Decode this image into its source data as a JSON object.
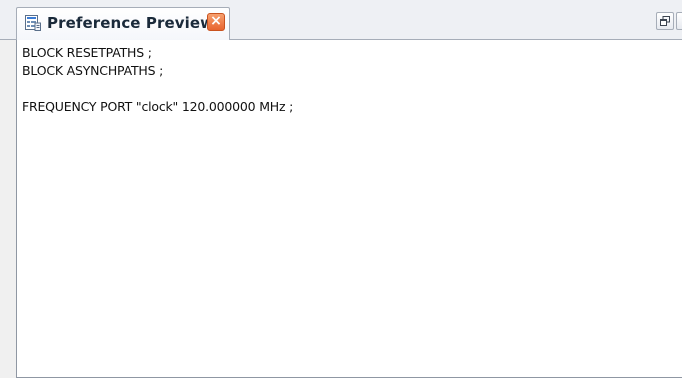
{
  "panel": {
    "tab_title": "Preference Preview",
    "tab_icon": "preference-sheet-icon",
    "close_icon": "close-icon",
    "restore_icon": "restore-window-icon",
    "close_color": "#e8642f"
  },
  "editor": {
    "lines": [
      "BLOCK RESETPATHS ;",
      "BLOCK ASYNCHPATHS ;",
      "",
      "FREQUENCY PORT \"clock\" 120.000000 MHz ;"
    ]
  }
}
